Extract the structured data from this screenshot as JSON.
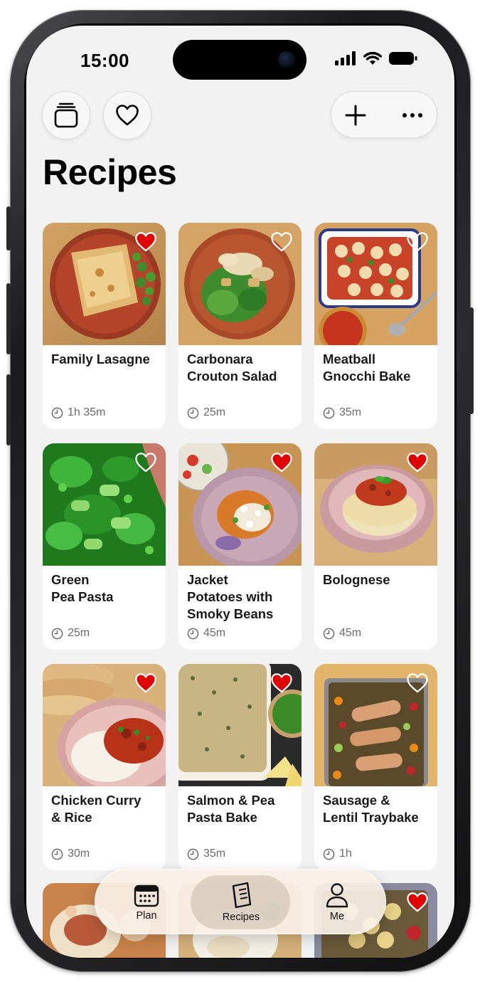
{
  "status_bar": {
    "time": "15:00"
  },
  "header": {
    "title": "Recipes",
    "buttons": {
      "collections": "collections-icon",
      "favourites": "heart-icon",
      "add": "plus-icon",
      "more": "ellipsis-icon"
    }
  },
  "colors": {
    "heart_filled": "#e00000",
    "background": "#f2f2f2"
  },
  "recipes": [
    {
      "title": "Family Lasagne",
      "time": "1h 35m",
      "favourite": true
    },
    {
      "title": "Carbonara\nCrouton Salad",
      "time": "25m",
      "favourite": false
    },
    {
      "title": "Meatball\nGnocchi Bake",
      "time": "35m",
      "favourite": false
    },
    {
      "title": "Green\nPea Pasta",
      "time": "25m",
      "favourite": false
    },
    {
      "title": "Jacket\nPotatoes with\nSmoky Beans",
      "time": "45m",
      "favourite": true
    },
    {
      "title": "Bolognese",
      "time": "45m",
      "favourite": true
    },
    {
      "title": "Chicken Curry\n& Rice",
      "time": "30m",
      "favourite": true
    },
    {
      "title": "Salmon & Pea\nPasta Bake",
      "time": "35m",
      "favourite": true
    },
    {
      "title": "Sausage &\nLentil Traybake",
      "time": "1h",
      "favourite": false
    }
  ],
  "tab_bar": {
    "tabs": [
      {
        "label": "Plan",
        "icon": "calendar-icon",
        "active": false
      },
      {
        "label": "Recipes",
        "icon": "recipe-book-icon",
        "active": true
      },
      {
        "label": "Me",
        "icon": "person-icon",
        "active": false
      }
    ]
  }
}
